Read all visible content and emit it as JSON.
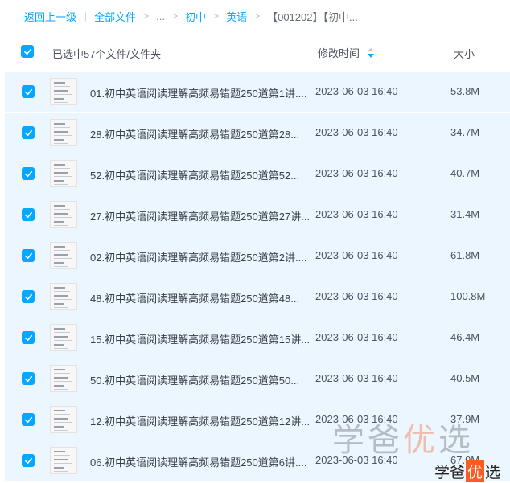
{
  "breadcrumb": {
    "back": "返回上一级",
    "all_files": "全部文件",
    "ellipsis": "...",
    "level1": "初中",
    "level2": "英语",
    "current": "【001202】【初中..."
  },
  "header": {
    "selected_label": "已选中57个文件/文件夹",
    "col_time": "修改时间",
    "col_size": "大小"
  },
  "files": [
    {
      "name": "01.初中英语阅读理解高频易错题250道第1讲....",
      "time": "2023-06-03 16:40",
      "size": "53.8M"
    },
    {
      "name": "28.初中英语阅读理解高频易错题250道第28...",
      "time": "2023-06-03 16:40",
      "size": "34.7M"
    },
    {
      "name": "52.初中英语阅读理解高频易错题250道第52...",
      "time": "2023-06-03 16:40",
      "size": "40.7M"
    },
    {
      "name": "27.初中英语阅读理解高频易错题250道第27讲...",
      "time": "2023-06-03 16:40",
      "size": "31.4M"
    },
    {
      "name": "02.初中英语阅读理解高频易错题250道第2讲....",
      "time": "2023-06-03 16:40",
      "size": "61.8M"
    },
    {
      "name": "48.初中英语阅读理解高频易错题250道第48...",
      "time": "2023-06-03 16:40",
      "size": "100.8M"
    },
    {
      "name": "15.初中英语阅读理解高频易错题250道第15讲...",
      "time": "2023-06-03 16:40",
      "size": "46.4M"
    },
    {
      "name": "50.初中英语阅读理解高频易错题250道第50...",
      "time": "2023-06-03 16:40",
      "size": "40.5M"
    },
    {
      "name": "12.初中英语阅读理解高频易错题250道第12讲...",
      "time": "2023-06-03 16:40",
      "size": "37.9M"
    },
    {
      "name": "06.初中英语阅读理解高频易错题250道第6讲....",
      "time": "2023-06-03 16:40",
      "size": "67.9M"
    }
  ],
  "watermark": {
    "big_a": "学爸",
    "big_b": "优",
    "big_c": "选",
    "small_a": "学爸",
    "small_b": "优",
    "small_c": "选"
  },
  "colors": {
    "accent": "#06a7ff",
    "row_selected_bg": "#ecf6ff",
    "watermark_highlight": "#ff5a1f"
  },
  "icons": {
    "checkbox": "checkbox-checked-icon",
    "sort": "sort-desc-icon",
    "thumbnail": "document-thumbnail-icon"
  }
}
